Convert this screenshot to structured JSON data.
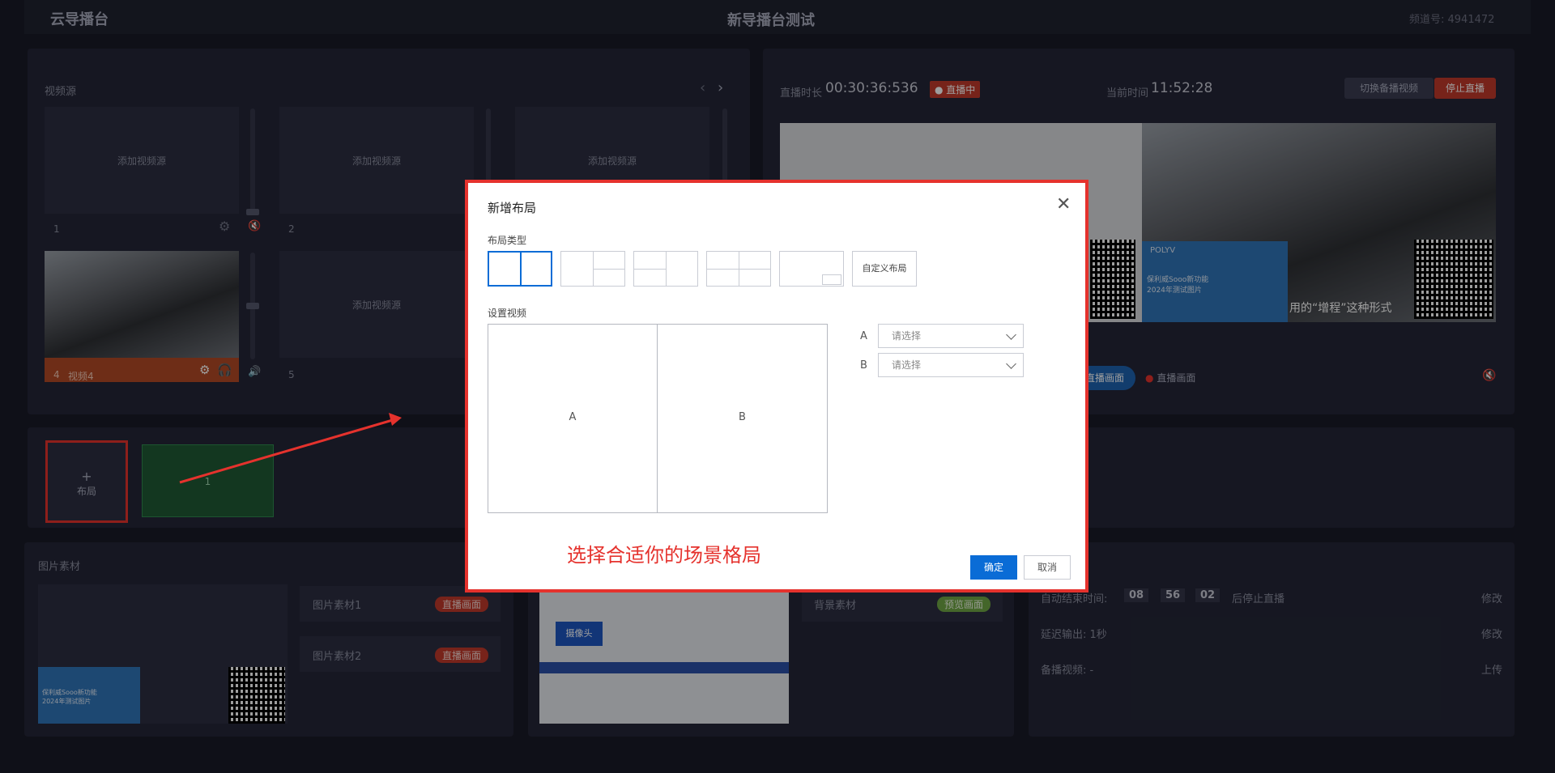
{
  "header": {
    "brand": "云导播台",
    "title": "新导播台测试",
    "channel": "频道号: 4941472"
  },
  "sources": {
    "section_title": "视频源",
    "add_label": "添加视频源",
    "slot_numbers": [
      "1",
      "2",
      "4",
      "5"
    ],
    "active_slot_label": "视频4"
  },
  "live": {
    "duration_label": "直播时长",
    "duration_value": "00:30:36:536",
    "status_badge": "直播中",
    "clock_label": "当前时间",
    "clock_value": "11:52:28",
    "switch_backup_btn": "切换备播视频",
    "stop_btn": "停止直播",
    "overlay_caption": "用的“增程”这种形式",
    "promo_text": "保利威Sooo新功能 2024年测试图片",
    "brand_logo": "POLYV",
    "live_screen_tab": "直播画面",
    "live_screen_tag": "直播画面"
  },
  "layouts": {
    "add_plus": "+",
    "add_label": "布局",
    "layout_one_label": "1"
  },
  "materials": {
    "section_title": "图片素材",
    "item1": "图片素材1",
    "item2": "图片素材2",
    "badge_live": "直播画面",
    "bg_item": "背景素材",
    "badge_preview": "预览画面",
    "promo_text": "保利威Sooo新功能 2024年测试图片",
    "cam_button": "摄像头"
  },
  "settings": {
    "auto_end_label": "自动结束时间:",
    "hh": "08",
    "mm": "56",
    "ss": "02",
    "auto_end_suffix": "后停止直播",
    "delay_label": "延迟输出:  1秒",
    "backup_label": "备播视频:  -",
    "edit": "修改",
    "upload": "上传"
  },
  "modal": {
    "title": "新增布局",
    "layout_type_label": "布局类型",
    "custom_layout_btn": "自定义布局",
    "set_video_label": "设置视频",
    "cell_a": "A",
    "cell_b": "B",
    "select_a_label": "A",
    "select_b_label": "B",
    "select_placeholder": "请选择",
    "confirm": "确定",
    "cancel": "取消",
    "annotation": "选择合适你的场景格局"
  },
  "colors": {
    "accent_red": "#e5322d",
    "primary_blue": "#0a6cd6",
    "bg": "#191a27"
  },
  "icons": [
    "close-icon",
    "gear-icon",
    "headphones-icon",
    "volume-icon",
    "mute-icon",
    "chevron-left-icon",
    "chevron-right-icon",
    "chevron-down-icon"
  ]
}
